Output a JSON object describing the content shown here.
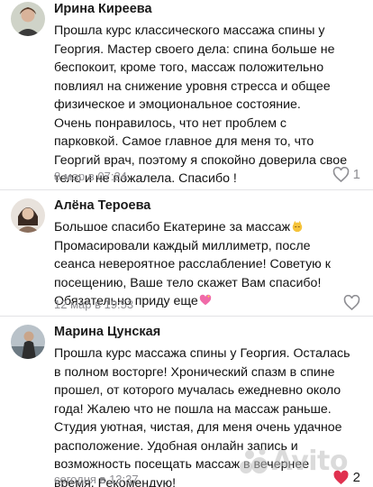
{
  "comments": [
    {
      "author": "Ирина Киреева",
      "text_lines": [
        "Прошла курс классического массажа спины у",
        "Георгия. Мастер своего дела: спина больше не",
        "беспокоит, кроме того, массаж положительно",
        "повлиял на снижение уровня стресса и общее",
        "физическое и эмоциональное состояние.",
        "Очень понравилось, что нет проблем с",
        "парковкой. Самое главное для меня то, что",
        "Георгий врач, поэтому я спокойно доверила свое",
        "тело и не пожалела. Спасибо !"
      ],
      "timestamp": "8 мар в 07:24",
      "likes": "1",
      "liked": false
    },
    {
      "author": "Алёна Тероева",
      "text_lines": [
        "Большое спасибо Екатерине за массаж",
        "Промасировали каждый миллиметр, после",
        "сеанса невероятное расслабление! Советую к",
        "посещению, Ваше тело скажет Вам спасибо!",
        "Обязательно приду еще"
      ],
      "timestamp": "12 мар в 19:53",
      "likes": "0",
      "liked": false
    },
    {
      "author": "Марина Цунская",
      "text_lines": [
        "Прошла курс массажа спины у Георгия. Осталась",
        "в полном восторге! Хронический спазм в спине",
        "прошел, от которого мучалась ежедневно около",
        "года! Жалею что не пошла на массаж раньше.",
        "Студия уютная, чистая, для меня очень удачное",
        "расположение. Удобная онлайн запись и",
        "возможность посещать массаж в вечернее",
        "время. Рекомендую!"
      ],
      "timestamp": "сегодня в 13:37",
      "likes": "2",
      "liked": true
    }
  ],
  "watermark": "Avito",
  "colors": {
    "meta_gray": "#8e8e93",
    "like_red": "#e0314f",
    "divider": "#e3e3e6"
  }
}
